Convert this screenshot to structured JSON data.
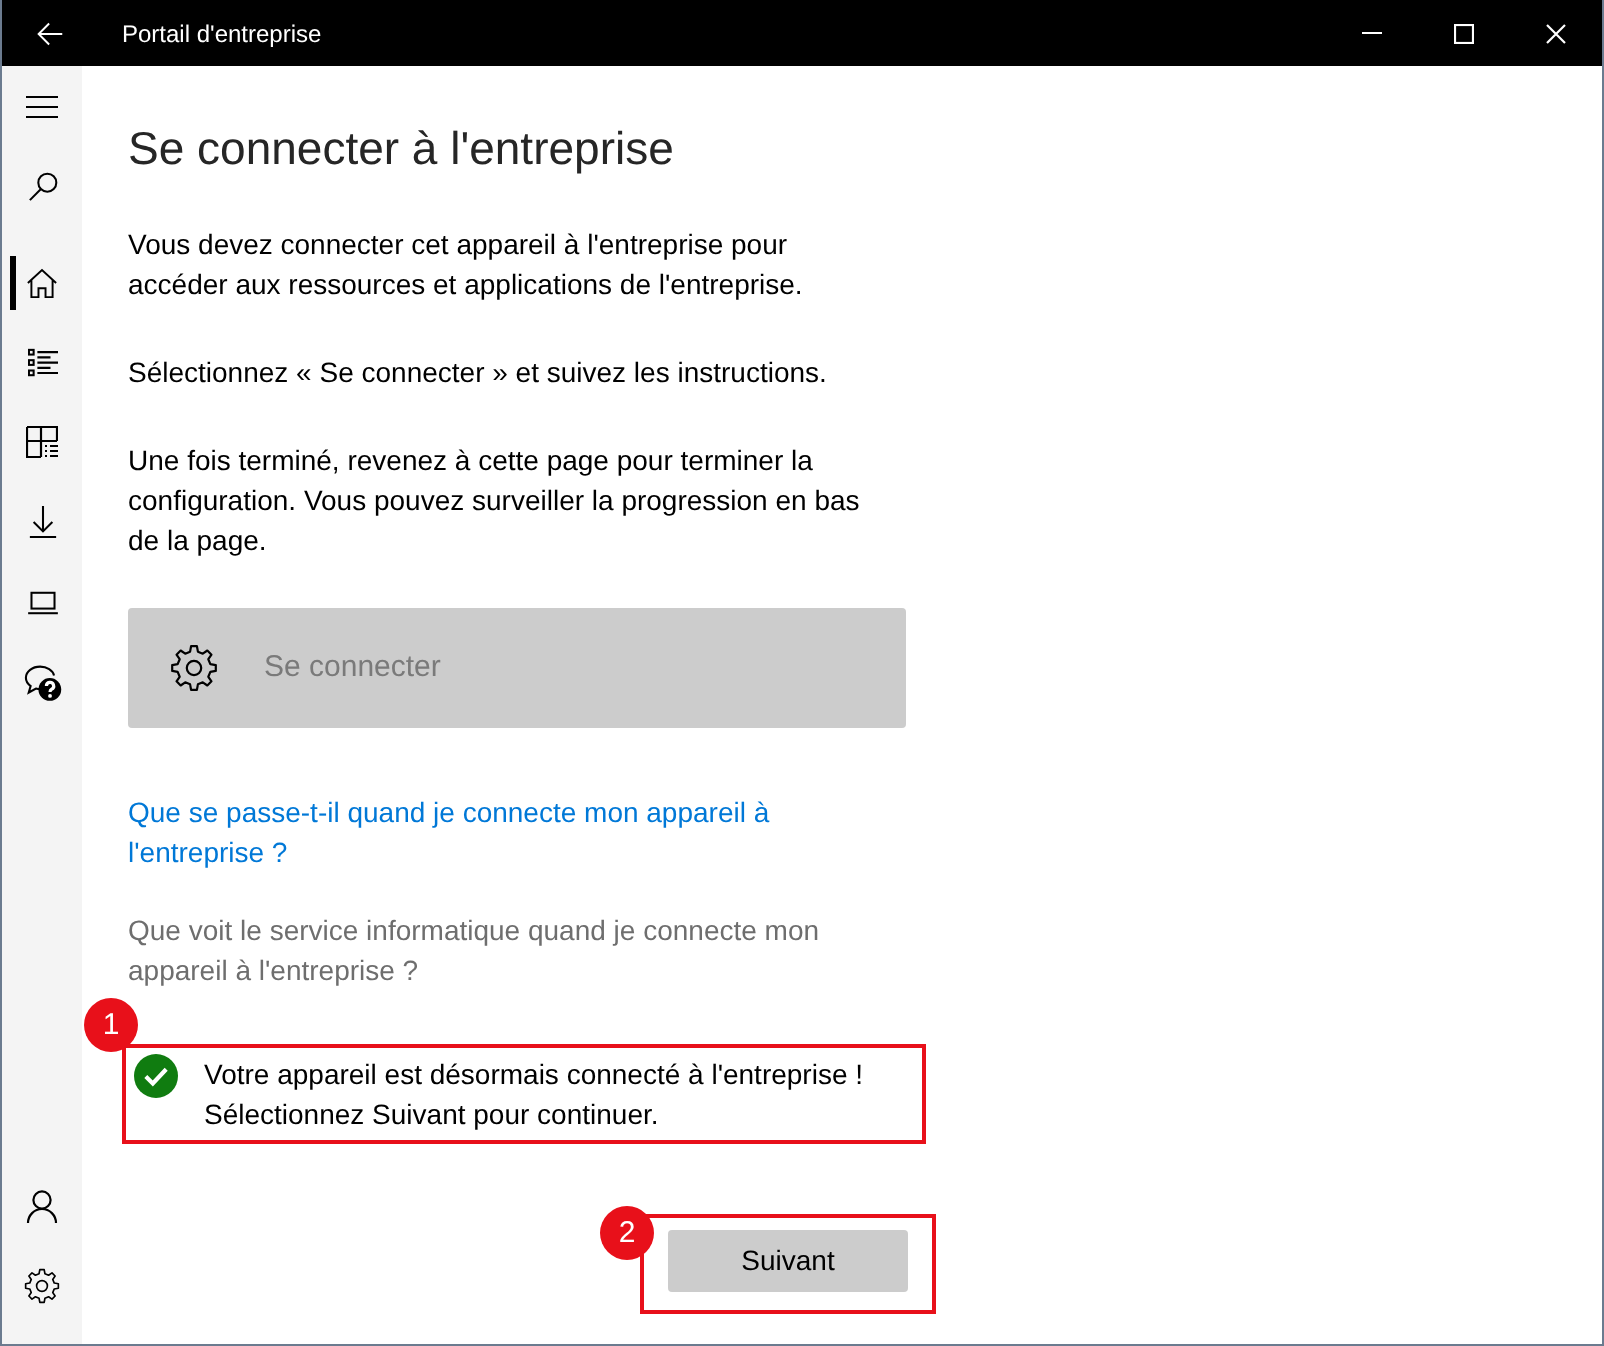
{
  "window": {
    "title": "Portail d'entreprise"
  },
  "nav": {
    "top": [
      {
        "kind": "menu"
      },
      {
        "kind": "search"
      }
    ],
    "items": [
      {
        "kind": "home",
        "selected": true
      },
      {
        "kind": "list",
        "selected": false
      },
      {
        "kind": "apps",
        "selected": false
      },
      {
        "kind": "download",
        "selected": false
      },
      {
        "kind": "device",
        "selected": false
      },
      {
        "kind": "help",
        "selected": false
      }
    ],
    "bottom": [
      {
        "kind": "account"
      },
      {
        "kind": "settings"
      }
    ]
  },
  "page": {
    "heading": "Se connecter à l'entreprise",
    "paragraphs": [
      "Vous devez connecter cet appareil à l'entreprise pour accéder aux ressources et applications de l'entreprise.",
      "Sélectionnez « Se connecter » et suivez les instructions.",
      "Une fois terminé, revenez à cette page pour terminer la configuration. Vous pouvez surveiller la progression en bas de la page."
    ],
    "connect_button": {
      "label": "Se connecter",
      "disabled": true
    },
    "links": [
      {
        "text": "Que se passe-t-il quand je connecte mon appareil à l'entreprise ?",
        "disabled": false
      },
      {
        "text": "Que voit le service informatique quand je connecte mon appareil à l'entreprise ?",
        "disabled": true
      }
    ],
    "status": {
      "kind": "success",
      "message": "Votre appareil est désormais connecté à l'entreprise ! Sélectionnez Suivant pour continuer.",
      "annotation": "1"
    },
    "next_button": {
      "label": "Suivant",
      "disabled": false,
      "annotation": "2"
    }
  }
}
